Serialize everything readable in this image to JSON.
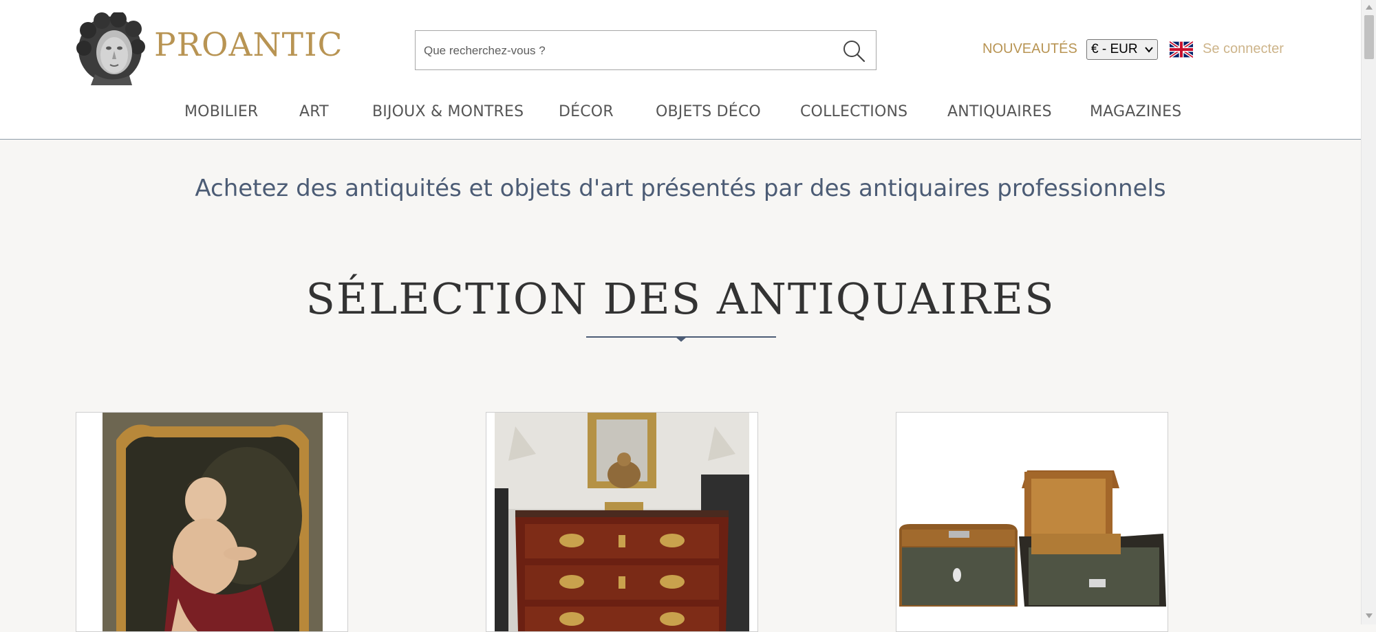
{
  "header": {
    "logo_text": "PROANTIC",
    "search": {
      "placeholder": "Que recherchez-vous ?",
      "value": ""
    },
    "new_label": "NOUVEAUTÉS",
    "currency": "€ - EUR",
    "language_flag": "uk-flag-icon",
    "login_label": "Se connecter"
  },
  "nav": {
    "items": [
      {
        "label": "MOBILIER"
      },
      {
        "label": "ART"
      },
      {
        "label": "BIJOUX & MONTRES"
      },
      {
        "label": "DÉCOR"
      },
      {
        "label": "OBJETS DÉCO"
      },
      {
        "label": "COLLECTIONS"
      },
      {
        "label": "ANTIQUAIRES"
      },
      {
        "label": "MAGAZINES"
      }
    ]
  },
  "main": {
    "tagline": "Achetez des antiquités et objets d'art présentés par des antiquaires professionnels",
    "section_title": "SÉLECTION DES ANTIQUAIRES",
    "cards": [
      {
        "image": "portrait-painting-child"
      },
      {
        "image": "louis-xv-commode"
      },
      {
        "image": "marquetry-boxes"
      }
    ]
  },
  "colors": {
    "brand_gold": "#b89453",
    "login_gold": "#cdb48a",
    "tagline_blue": "#4c5c75",
    "background": "#f7f6f4"
  }
}
